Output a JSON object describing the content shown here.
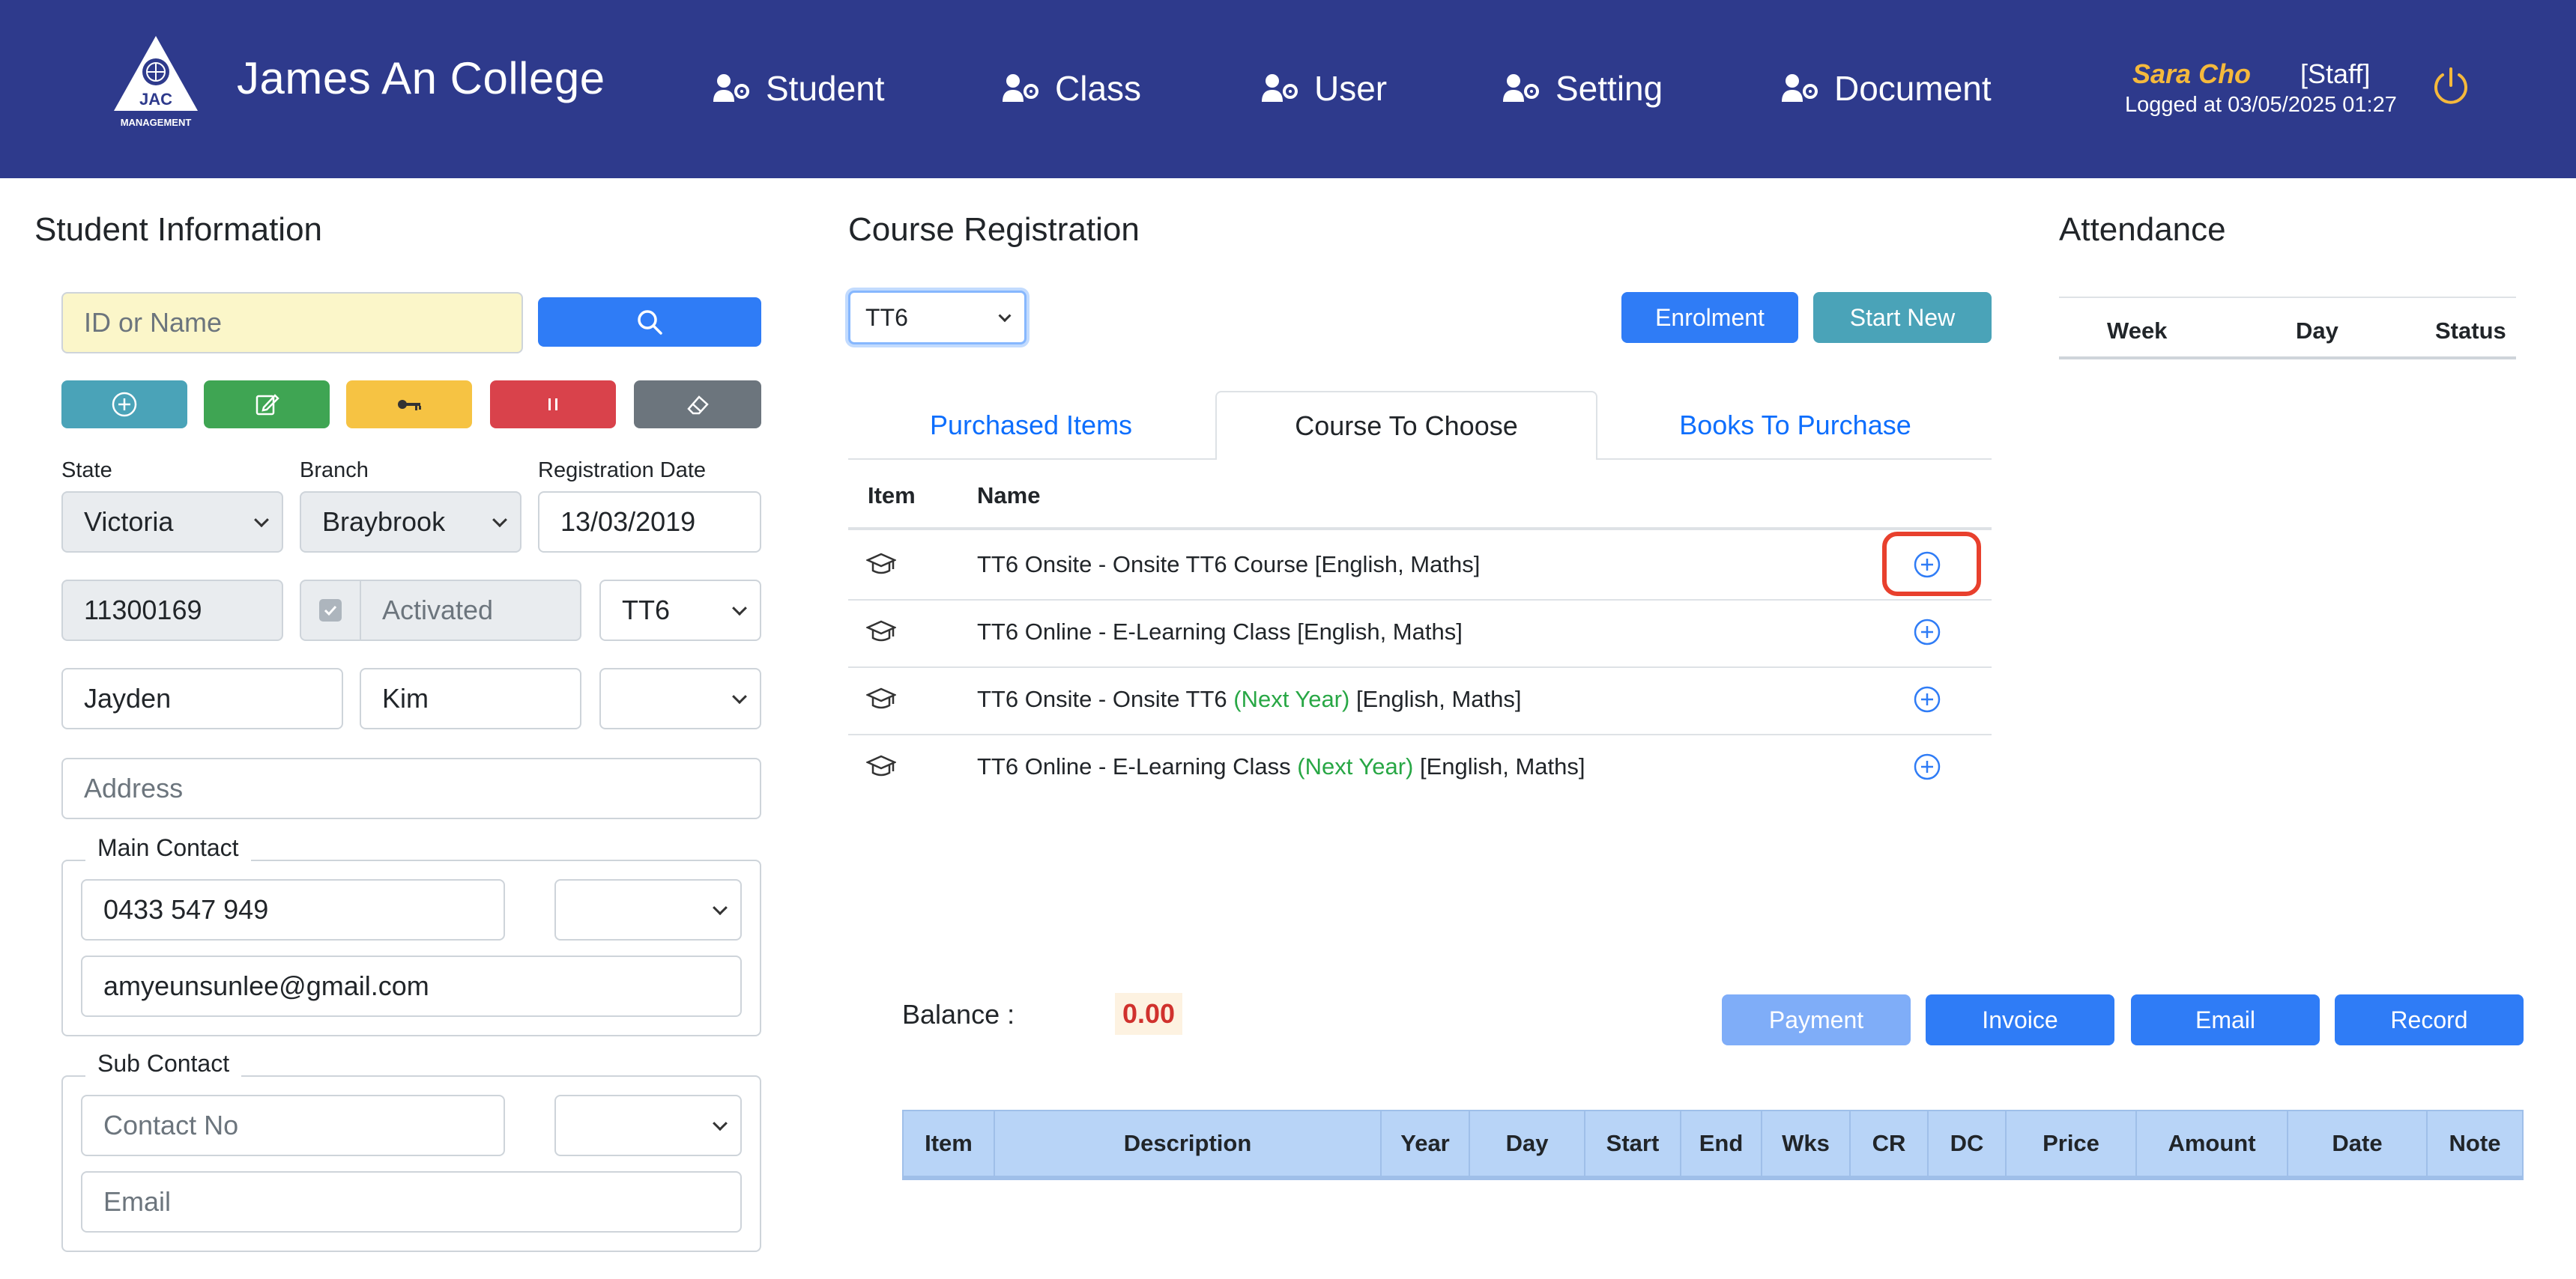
{
  "header": {
    "logo_text": "JAC",
    "logo_subtext": "MANAGEMENT",
    "brand": "James An College",
    "nav": [
      {
        "label": "Student"
      },
      {
        "label": "Class"
      },
      {
        "label": "User"
      },
      {
        "label": "Setting"
      },
      {
        "label": "Document"
      }
    ],
    "user_name": "Sara Cho",
    "user_role": "[Staff]",
    "logged_at": "Logged at 03/05/2025 01:27",
    "power_icon": "power-icon"
  },
  "student_info": {
    "title": "Student Information",
    "search_placeholder": "ID or Name",
    "action_buttons": [
      {
        "icon": "plus-circle-icon",
        "color": "#17a2b8"
      },
      {
        "icon": "edit-icon",
        "color": "#28a745"
      },
      {
        "icon": "key-icon",
        "color": "#f6c343"
      },
      {
        "icon": "pause-icon",
        "color": "#dc3545"
      },
      {
        "icon": "eraser-icon",
        "color": "#6c757d"
      }
    ],
    "state_label": "State",
    "state_value": "Victoria",
    "branch_label": "Branch",
    "branch_value": "Braybrook",
    "reg_date_label": "Registration Date",
    "reg_date_value": "13/03/2019",
    "student_id": "11300169",
    "activated_label": "Activated",
    "grade": "TT6",
    "first_name": "Jayden",
    "last_name": "Kim",
    "address_placeholder": "Address",
    "main_contact": {
      "legend": "Main Contact",
      "phone": "0433 547 949",
      "email": "amyeunsunlee@gmail.com"
    },
    "sub_contact": {
      "legend": "Sub Contact",
      "phone_placeholder": "Contact No",
      "email_placeholder": "Email"
    }
  },
  "course_reg": {
    "title": "Course Registration",
    "grade_select": "TT6",
    "enrolment_label": "Enrolment",
    "start_new_label": "Start New",
    "tabs": [
      {
        "label": "Purchased Items"
      },
      {
        "label": "Course To Choose"
      },
      {
        "label": "Books To Purchase"
      }
    ],
    "col_item": "Item",
    "col_name": "Name",
    "rows": [
      {
        "a": "TT6 Onsite - Onsite TT6 Course [English, Maths]",
        "b": "",
        "c": ""
      },
      {
        "a": "TT6 Online - E-Learning Class [English, Maths]",
        "b": "",
        "c": ""
      },
      {
        "a": "TT6 Onsite - Onsite TT6 ",
        "b": "(Next Year)",
        "c": " [English, Maths]"
      },
      {
        "a": "TT6 Online - E-Learning Class ",
        "b": "(Next Year)",
        "c": " [English, Maths]"
      }
    ],
    "balance_label": "Balance :",
    "balance_value": "0.00",
    "payment_label": "Payment",
    "invoice_label": "Invoice",
    "email_label": "Email",
    "record_label": "Record",
    "table_columns": [
      "Item",
      "Description",
      "Year",
      "Day",
      "Start",
      "End",
      "Wks",
      "CR",
      "DC",
      "Price",
      "Amount",
      "Date",
      "Note"
    ]
  },
  "attendance": {
    "title": "Attendance",
    "columns": [
      "Week",
      "Day",
      "Status"
    ]
  },
  "colors": {
    "header_bg": "#2e3a8c",
    "primary": "#2f7cf6",
    "teal": "#4aa3b8",
    "highlight": "#e8402d"
  }
}
